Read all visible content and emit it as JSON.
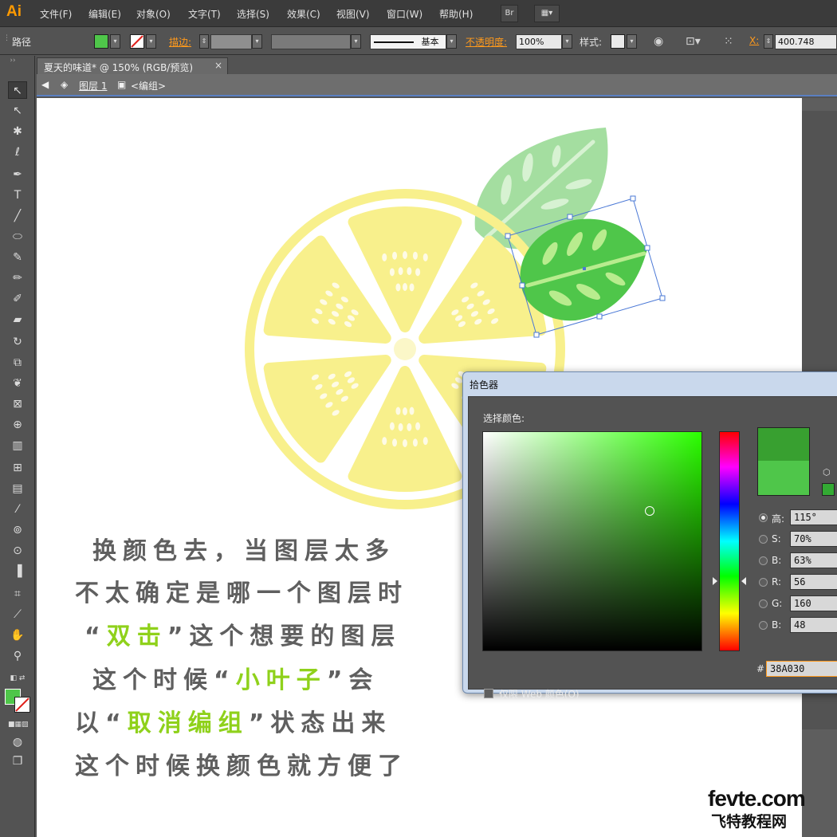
{
  "app": {
    "logo": "Ai"
  },
  "menubar": {
    "items": [
      "文件(F)",
      "编辑(E)",
      "对象(O)",
      "文字(T)",
      "选择(S)",
      "效果(C)",
      "视图(V)",
      "窗口(W)",
      "帮助(H)"
    ],
    "bridge_label": "Br"
  },
  "controlbar": {
    "object_type": "路径",
    "stroke_label": "描边:",
    "stroke_profile": "基本",
    "opacity_label": "不透明度:",
    "opacity_value": "100%",
    "style_label": "样式:",
    "x_label": "X:",
    "x_value": "400.748"
  },
  "document": {
    "tab_title": "夏天的味道* @ 150% (RGB/预览)",
    "close_glyph": "×"
  },
  "breadcrumb": {
    "layer": "图层 1",
    "group": "<编组>"
  },
  "instructions": {
    "line1": "换颜色去，当图层太多",
    "line2": "不太确定是哪一个图层时",
    "line3_q1": "“",
    "line3_hl": "双击",
    "line3_q2": "”",
    "line3_rest": "这个想要的图层",
    "line4_pre": "这个时候“",
    "line4_hl": "小叶子",
    "line4_post": "”会",
    "line5_pre": "以“",
    "line5_hl": "取消编组",
    "line5_post": "”状态出来",
    "line6": "这个时候换颜色就方便了"
  },
  "color_picker": {
    "title": "拾色器",
    "select_label": "选择颜色:",
    "fields": [
      {
        "label": "高:",
        "value": "115°",
        "selected": true
      },
      {
        "label": "S:",
        "value": "70%",
        "selected": false
      },
      {
        "label": "B:",
        "value": "63%",
        "selected": false
      },
      {
        "label": "R:",
        "value": "56",
        "selected": false
      },
      {
        "label": "G:",
        "value": "160",
        "selected": false
      },
      {
        "label": "B:",
        "value": "48",
        "selected": false
      }
    ],
    "hex_prefix": "#",
    "hex_value": "38A030",
    "web_only_label": "仅限 Web 颜色(O)",
    "new_color": "#38a030",
    "old_color": "#4fc64a"
  },
  "watermark": {
    "top": "fevte.com",
    "bottom": "飞特教程网"
  },
  "colors": {
    "fill": "#4fc64a",
    "lemon": "#f8f08c",
    "leaf_light": "#a4dea0",
    "leaf_selected": "#4fc64a",
    "highlight_text": "#8fd11b",
    "selection_box": "#4a78d6"
  }
}
